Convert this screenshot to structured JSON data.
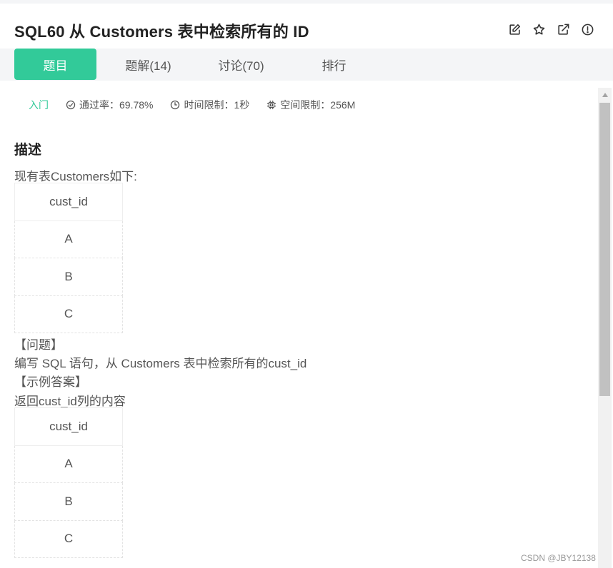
{
  "header": {
    "title": "SQL60  从 Customers 表中检索所有的 ID",
    "actions": [
      "edit-icon",
      "star-icon",
      "external-link-icon",
      "alert-icon"
    ]
  },
  "tabs": [
    {
      "label": "题目",
      "active": true
    },
    {
      "label": "题解(14)",
      "active": false
    },
    {
      "label": "讨论(70)",
      "active": false
    },
    {
      "label": "排行",
      "active": false
    }
  ],
  "meta": {
    "level": "入门",
    "pass_rate": "通过率：69.78%",
    "time_limit": "时间限制：1秒",
    "space_limit": "空间限制：256M"
  },
  "content": {
    "heading": "描述",
    "intro": "现有表Customers如下:",
    "table1": {
      "header": "cust_id",
      "rows": [
        "A",
        "B",
        "C"
      ]
    },
    "question_label": "【问题】",
    "question": "编写 SQL 语句，从 Customers 表中检索所有的cust_id",
    "example_label": "【示例答案】",
    "example_intro": "返回cust_id列的内容",
    "table2": {
      "header": "cust_id",
      "rows": [
        "A",
        "B",
        "C"
      ]
    }
  },
  "watermark": "CSDN @JBY12138",
  "colors": {
    "accent": "#32ca99",
    "tabbar_bg": "#f4f5f7"
  }
}
